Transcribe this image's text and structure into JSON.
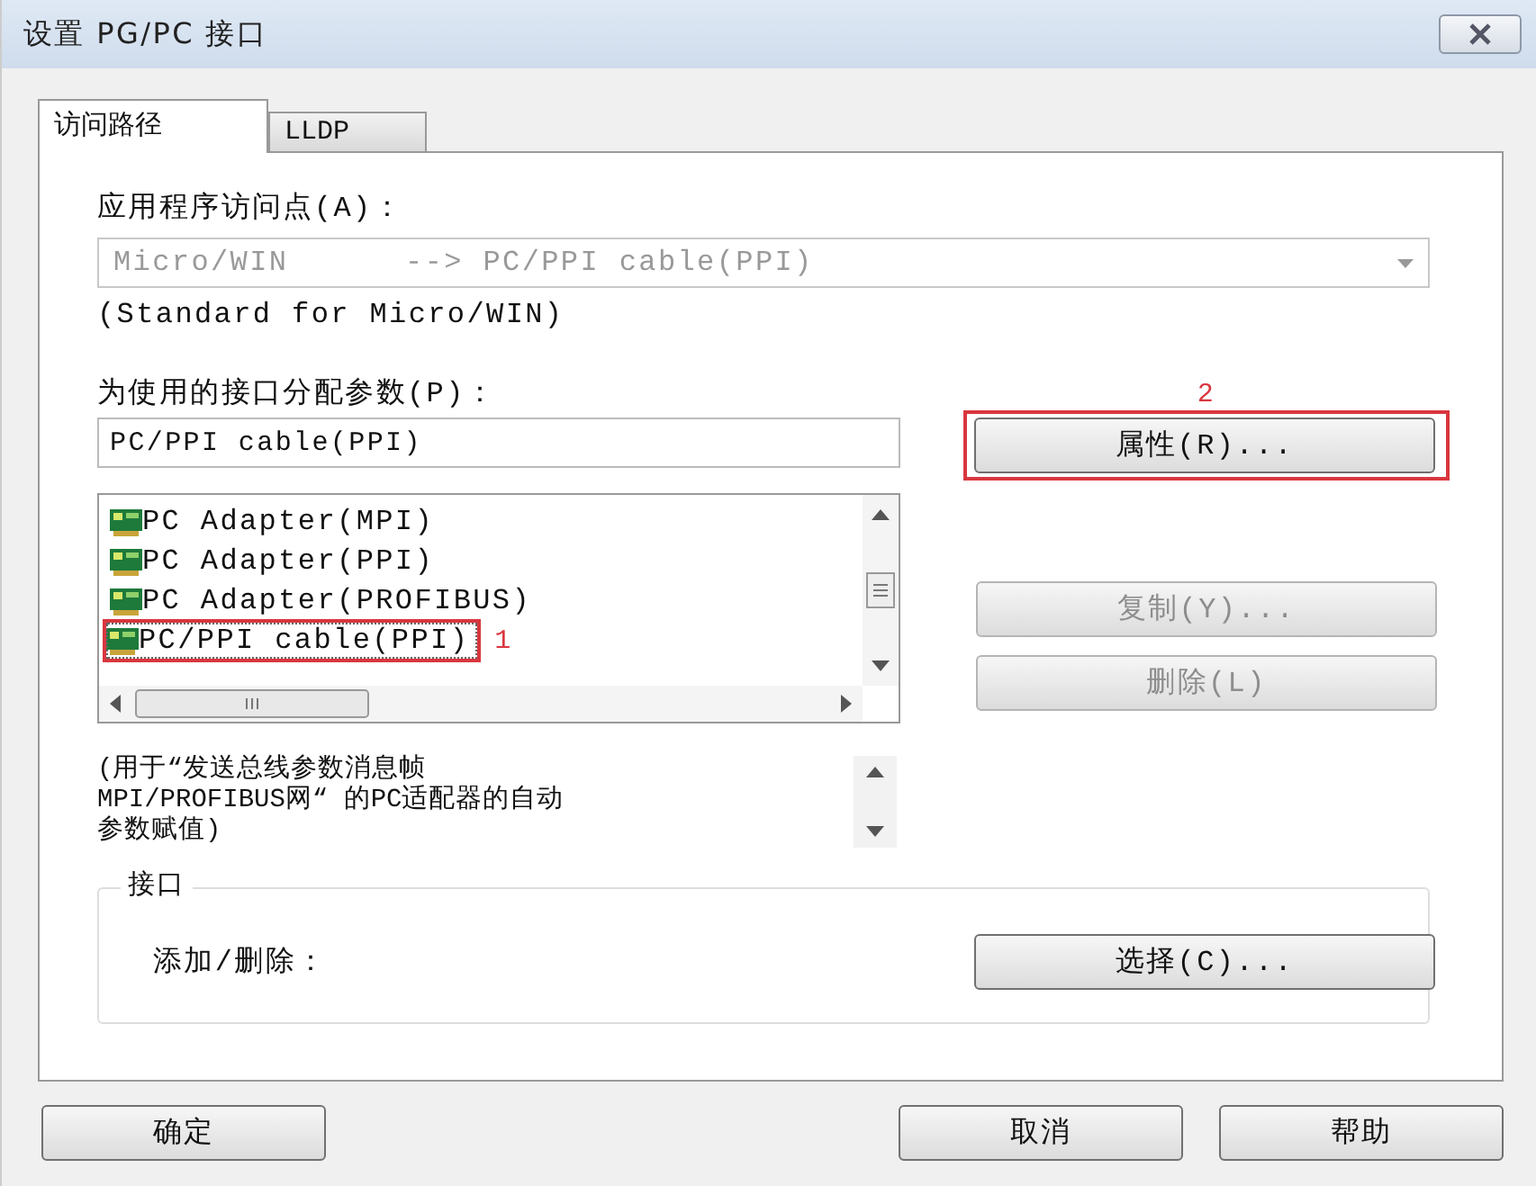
{
  "window": {
    "title": "设置 PG/PC 接口"
  },
  "tabs": [
    {
      "label": "访问路径",
      "selected": true
    },
    {
      "label": "LLDP",
      "selected": false
    }
  ],
  "access_point": {
    "label": "应用程序访问点(A)：",
    "value": "Micro/WIN      --> PC/PPI cable(PPI)",
    "disabled": true,
    "note": "(Standard for Micro/WIN)"
  },
  "interface_params": {
    "label": "为使用的接口分配参数(P)：",
    "value": "PC/PPI cable(PPI)"
  },
  "interfaces": [
    {
      "label": "PC Adapter(MPI)",
      "selected": false
    },
    {
      "label": "PC Adapter(PPI)",
      "selected": false
    },
    {
      "label": "PC Adapter(PROFIBUS)",
      "selected": false
    },
    {
      "label": "PC/PPI cable(PPI)",
      "selected": true,
      "callout": "1"
    }
  ],
  "description": [
    "(用于“发送总线参数消息帧",
    "MPI/PROFIBUS网“ 的PC适配器的自动",
    "参数赋值)"
  ],
  "side_buttons": [
    {
      "label": "属性(R)...",
      "disabled": false,
      "callout": "2"
    },
    {
      "label": "复制(Y)...",
      "disabled": true
    },
    {
      "label": "删除(L)",
      "disabled": true
    }
  ],
  "interface_group": {
    "title": "接口",
    "label": "添加/删除：",
    "button": "选择(C)..."
  },
  "footer": {
    "left_buttons": [
      "确定"
    ],
    "right_buttons": [
      "取消",
      "帮助"
    ]
  }
}
